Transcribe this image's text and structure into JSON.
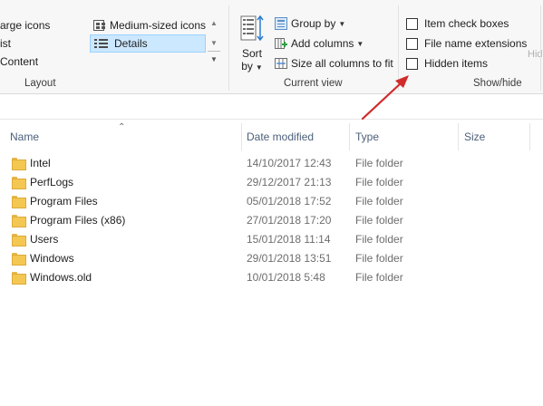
{
  "ribbon": {
    "layout": {
      "items": {
        "large_icons": "arge icons",
        "list": "ist",
        "content": "Content",
        "medium_icons": "Medium-sized icons",
        "details": "Details"
      },
      "group_label": "Layout"
    },
    "current_view": {
      "sort_by_line1": "Sort",
      "sort_by_line2": "by",
      "group_by": "Group by",
      "add_columns": "Add columns",
      "size_all_columns": "Size all columns to fit",
      "group_label": "Current view"
    },
    "show_hide": {
      "item_check_boxes": "Item check boxes",
      "file_name_extensions": "File name extensions",
      "hidden_items": "Hidden items",
      "hide_partial": "Hid",
      "group_label": "Show/hide"
    }
  },
  "columns": {
    "name": "Name",
    "date_modified": "Date modified",
    "type": "Type",
    "size": "Size"
  },
  "files": [
    {
      "name": "Intel",
      "date": "14/10/2017 12:43",
      "type": "File folder"
    },
    {
      "name": "PerfLogs",
      "date": "29/12/2017 21:13",
      "type": "File folder"
    },
    {
      "name": "Program Files",
      "date": "05/01/2018 17:52",
      "type": "File folder"
    },
    {
      "name": "Program Files (x86)",
      "date": "27/01/2018 17:20",
      "type": "File folder"
    },
    {
      "name": "Users",
      "date": "15/01/2018 11:14",
      "type": "File folder"
    },
    {
      "name": "Windows",
      "date": "29/01/2018 13:51",
      "type": "File folder"
    },
    {
      "name": "Windows.old",
      "date": "10/01/2018 5:48",
      "type": "File folder"
    }
  ],
  "colors": {
    "accent_selected": "#cce8ff",
    "annotation_arrow": "#d12b2b",
    "folder": "#f4c752"
  },
  "icons": {
    "sort_by": "sort-by-icon",
    "group_by": "group-by-icon",
    "add_columns": "add-columns-icon",
    "size_columns": "size-columns-icon"
  }
}
